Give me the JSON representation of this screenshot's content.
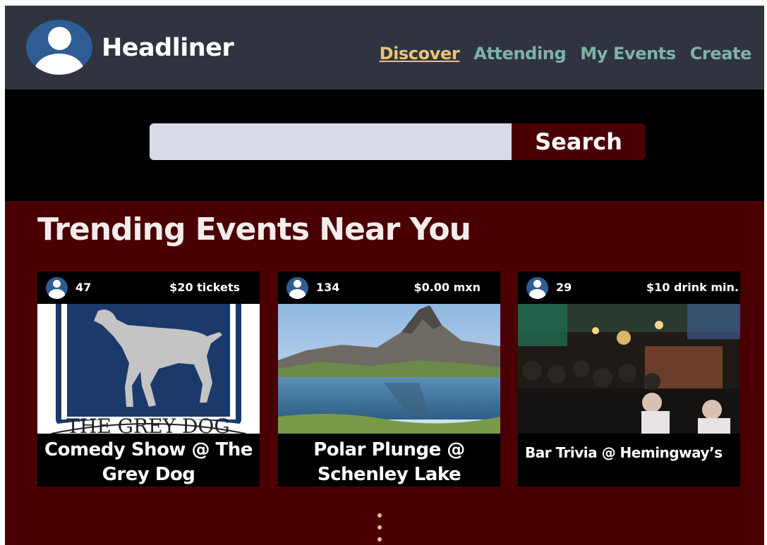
{
  "header": {
    "brand": "Headliner",
    "nav": [
      {
        "label": "Discover",
        "active": true
      },
      {
        "label": "Attending",
        "active": false
      },
      {
        "label": "My Events",
        "active": false
      },
      {
        "label": "Create",
        "active": false
      }
    ]
  },
  "search": {
    "value": "",
    "placeholder": "",
    "button_label": "Search"
  },
  "trending": {
    "title": "Trending Events Near You",
    "events": [
      {
        "attendees": "47",
        "price": "$20 tickets",
        "title": "Comedy Show @ The Grey Dog",
        "image_text": "THE GREY DOG"
      },
      {
        "attendees": "134",
        "price": "$0.00 mxn",
        "title": "Polar Plunge @ Schenley Lake"
      },
      {
        "attendees": "29",
        "price": "$10 drink min.",
        "title": "Bar Trivia @ Hemingway’s"
      }
    ]
  },
  "colors": {
    "header_bg": "#2f3440",
    "accent": "#e9c27a",
    "nav": "#7fb3a8",
    "maroon": "#4a0003"
  }
}
